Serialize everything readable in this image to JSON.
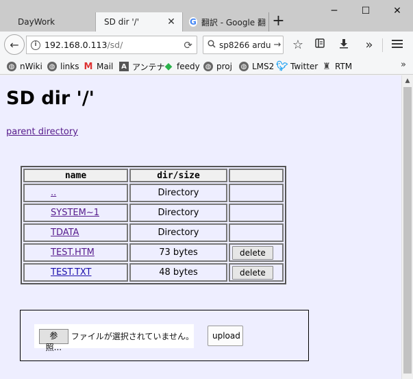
{
  "browser": {
    "tabs": [
      {
        "label": "DayWork"
      },
      {
        "label": "SD dir '/'",
        "active": true
      },
      {
        "label": "翻訳 - Google 翻"
      }
    ],
    "new_tab_label": "+",
    "window_controls": {
      "minimize": "─",
      "maximize": "☐",
      "close": "✕"
    },
    "url": {
      "host": "192.168.0.113",
      "path": "/sd/"
    },
    "search": {
      "value": "sp8266 ardu"
    },
    "bookmarks": [
      {
        "label": "nWiki",
        "icon": "globe-icon"
      },
      {
        "label": "links",
        "icon": "globe-icon"
      },
      {
        "label": "Mail",
        "icon": "gmail-icon"
      },
      {
        "label": "アンテナ",
        "icon": "antenna-icon"
      },
      {
        "label": "feedy",
        "icon": "feedly-icon"
      },
      {
        "label": "proj",
        "icon": "globe-icon"
      },
      {
        "label": "LMS2",
        "icon": "globe-icon"
      },
      {
        "label": "Twitter",
        "icon": "twitter-icon"
      },
      {
        "label": "RTM",
        "icon": "rtm-icon"
      }
    ],
    "more_bookmarks": "»"
  },
  "page": {
    "title": "SD dir '/'",
    "parent_link": "parent directory",
    "table": {
      "headers": {
        "name": "name",
        "size": "dir/size",
        "action": ""
      },
      "rows": [
        {
          "name": "..",
          "size": "Directory",
          "action": ""
        },
        {
          "name": "SYSTEM~1",
          "size": "Directory",
          "action": ""
        },
        {
          "name": "TDATA",
          "size": "Directory",
          "action": ""
        },
        {
          "name": "TEST.HTM",
          "size": "73 bytes",
          "action": "delete"
        },
        {
          "name": "TEST.TXT",
          "size": "48 bytes",
          "action": "delete"
        }
      ]
    },
    "upload": {
      "browse_label": "参照...",
      "no_file_text": "ファイルが選択されていません。",
      "upload_label": "upload"
    }
  },
  "colors": {
    "page_background": "#eeeeff",
    "visited_link": "#551a8b",
    "unvisited_link": "#1a0dab",
    "tab_strip": "#cbcbcb"
  }
}
